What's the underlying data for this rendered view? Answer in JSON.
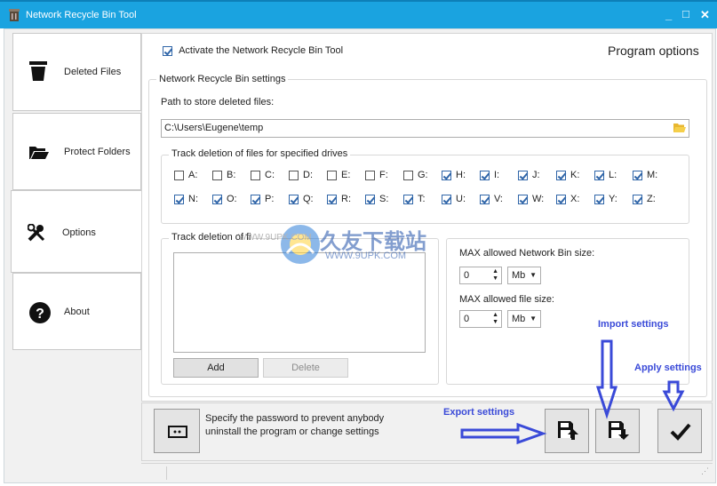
{
  "window": {
    "title": "Network Recycle Bin Tool",
    "minimize": "_",
    "maximize": "□",
    "close": "✕"
  },
  "sidebar": {
    "items": [
      {
        "label": "Deleted Files",
        "icon": "trash-icon"
      },
      {
        "label": "Protect Folders",
        "icon": "folder-open-icon"
      },
      {
        "label": "Options",
        "icon": "tools-icon"
      },
      {
        "label": "About",
        "icon": "help-icon"
      }
    ]
  },
  "options": {
    "activate_label": "Activate the Network Recycle Bin Tool",
    "activate_checked": true,
    "header": "Program options",
    "settings_group": "Network Recycle Bin settings",
    "path_label": "Path to store deleted files:",
    "path_value": "C:\\Users\\Eugene\\temp",
    "drives_group": "Track deletion of files for specified drives",
    "drives_row1": [
      {
        "l": "A:",
        "c": false
      },
      {
        "l": "B:",
        "c": false
      },
      {
        "l": "C:",
        "c": false
      },
      {
        "l": "D:",
        "c": false
      },
      {
        "l": "E:",
        "c": false
      },
      {
        "l": "F:",
        "c": false
      },
      {
        "l": "G:",
        "c": false
      },
      {
        "l": "H:",
        "c": true
      },
      {
        "l": "I:",
        "c": true
      },
      {
        "l": "J:",
        "c": true
      },
      {
        "l": "K:",
        "c": true
      },
      {
        "l": "L:",
        "c": true
      },
      {
        "l": "M:",
        "c": true
      }
    ],
    "drives_row2": [
      {
        "l": "N:",
        "c": true
      },
      {
        "l": "O:",
        "c": true
      },
      {
        "l": "P:",
        "c": true
      },
      {
        "l": "Q:",
        "c": true
      },
      {
        "l": "R:",
        "c": true
      },
      {
        "l": "S:",
        "c": true
      },
      {
        "l": "T:",
        "c": true
      },
      {
        "l": "U:",
        "c": true
      },
      {
        "l": "V:",
        "c": true
      },
      {
        "l": "W:",
        "c": true
      },
      {
        "l": "X:",
        "c": true
      },
      {
        "l": "Y:",
        "c": true
      },
      {
        "l": "Z:",
        "c": true
      }
    ],
    "track_group": "Track deletion of fi",
    "add_label": "Add",
    "delete_label": "Delete",
    "max_bin_label": "MAX allowed Network Bin size:",
    "max_bin_value": "0",
    "max_bin_unit": "Mb",
    "max_file_label": "MAX allowed file size:",
    "max_file_value": "0",
    "max_file_unit": "Mb"
  },
  "bottom": {
    "password_text_1": "Specify the password to prevent anybody",
    "password_text_2": "uninstall the program or change settings"
  },
  "annotations": {
    "export": "Export settings",
    "import": "Import settings",
    "apply": "Apply settings"
  },
  "watermark": {
    "site": "WWW.9UPK.COM",
    "brand": "久友下载站",
    "brand_url": "WWW.9UPK.COM"
  },
  "colors": {
    "titlebar": "#1aa3e0",
    "annotation": "#3a4ad8",
    "check": "#2f65a8"
  }
}
